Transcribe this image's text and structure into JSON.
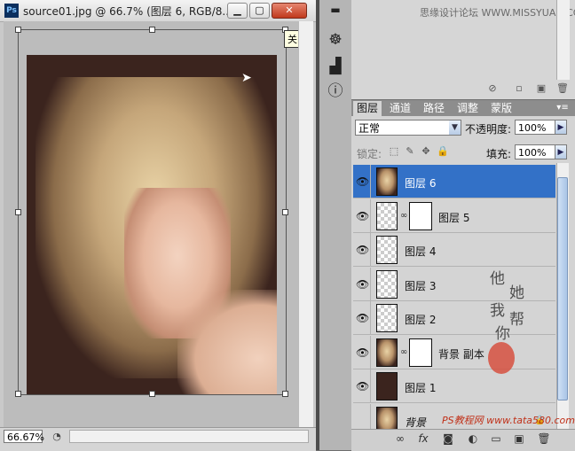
{
  "document": {
    "title": "source01.jpg @ 66.7% (图层 6, RGB/8...",
    "close_tooltip": "关闭",
    "zoom": "66.67%",
    "app_badge": "Ps"
  },
  "top_panel": {
    "watermark": "思缘设计论坛  WWW.MISSYUAN.COM"
  },
  "layers_panel": {
    "tabs": [
      {
        "label": "图层",
        "active": true
      },
      {
        "label": "通道",
        "active": false
      },
      {
        "label": "路径",
        "active": false
      },
      {
        "label": "调整",
        "active": false
      },
      {
        "label": "蒙版",
        "active": false
      }
    ],
    "blend_mode": "正常",
    "opacity_label": "不透明度:",
    "opacity_value": "100%",
    "lock_label": "锁定:",
    "fill_label": "填充:",
    "fill_value": "100%",
    "layers": [
      {
        "name": "图层 6",
        "selected": true,
        "visible": true,
        "thumb": "photo",
        "mask": false
      },
      {
        "name": "图层 5",
        "selected": false,
        "visible": true,
        "thumb": "transparent",
        "mask": true
      },
      {
        "name": "图层 4",
        "selected": false,
        "visible": true,
        "thumb": "transparent",
        "mask": false
      },
      {
        "name": "图层 3",
        "selected": false,
        "visible": true,
        "thumb": "transparent",
        "mask": false
      },
      {
        "name": "图层 2",
        "selected": false,
        "visible": true,
        "thumb": "transparent",
        "mask": false
      },
      {
        "name": "背景 副本",
        "selected": false,
        "visible": true,
        "thumb": "photo",
        "mask": true
      },
      {
        "name": "图层 1",
        "selected": false,
        "visible": true,
        "thumb": "dark",
        "mask": false
      },
      {
        "name": "背景",
        "selected": false,
        "visible": false,
        "thumb": "photo",
        "mask": false
      }
    ],
    "watermark_vertical": [
      "他",
      "她",
      "我",
      "帮",
      "你"
    ],
    "watermark_bottom": "PS教程网  www.tata580.com"
  }
}
